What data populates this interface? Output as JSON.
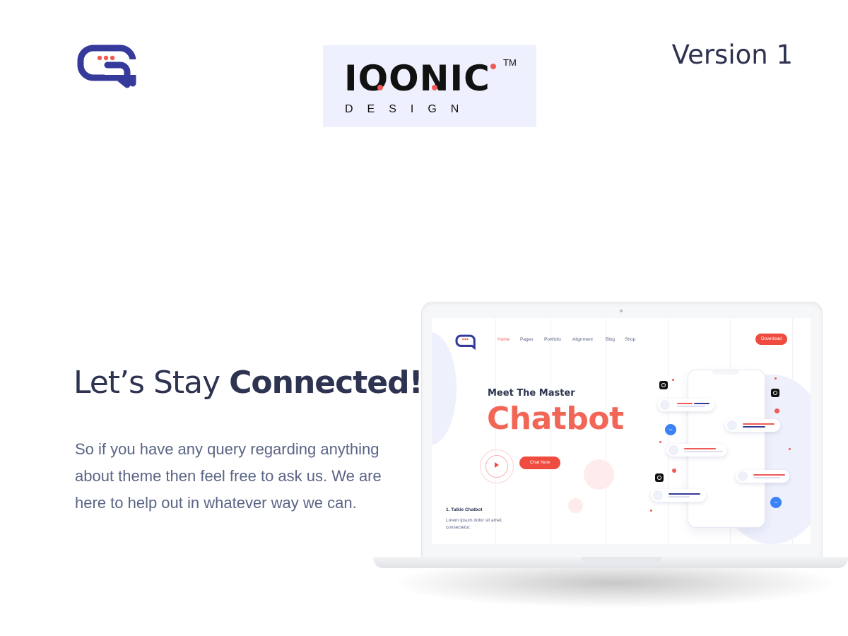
{
  "brand": {
    "icon": "chat-bubble-logo",
    "colors": {
      "primary": "#363a9b",
      "accent": "#ef5a56"
    }
  },
  "badge": {
    "wordmark": "IOONIC",
    "trademark": "TM",
    "subtitle": "DESIGN"
  },
  "version": "Version 1",
  "hero": {
    "headline_light": "Let’s Stay ",
    "headline_bold": "Connected!",
    "body": "So if you have any query regarding anything about theme then feel free to ask us. We are here to help out in whatever way we can."
  },
  "mockup": {
    "nav": [
      "Home",
      "Pages",
      "Portfolio",
      "Alignment",
      "Blog",
      "Shop"
    ],
    "active_nav": "Home",
    "download_label": "Download",
    "kicker": "Meet The Master",
    "title": "Chatbot",
    "cta_label": "Chat Now",
    "feature_title": "1. Talkie Chatbot",
    "feature_text": "Lorem ipsum dolor sit amet, consectetur.",
    "colors": {
      "accent": "#ef4b3f",
      "title": "#f26658",
      "dark": "#2d3350"
    }
  }
}
